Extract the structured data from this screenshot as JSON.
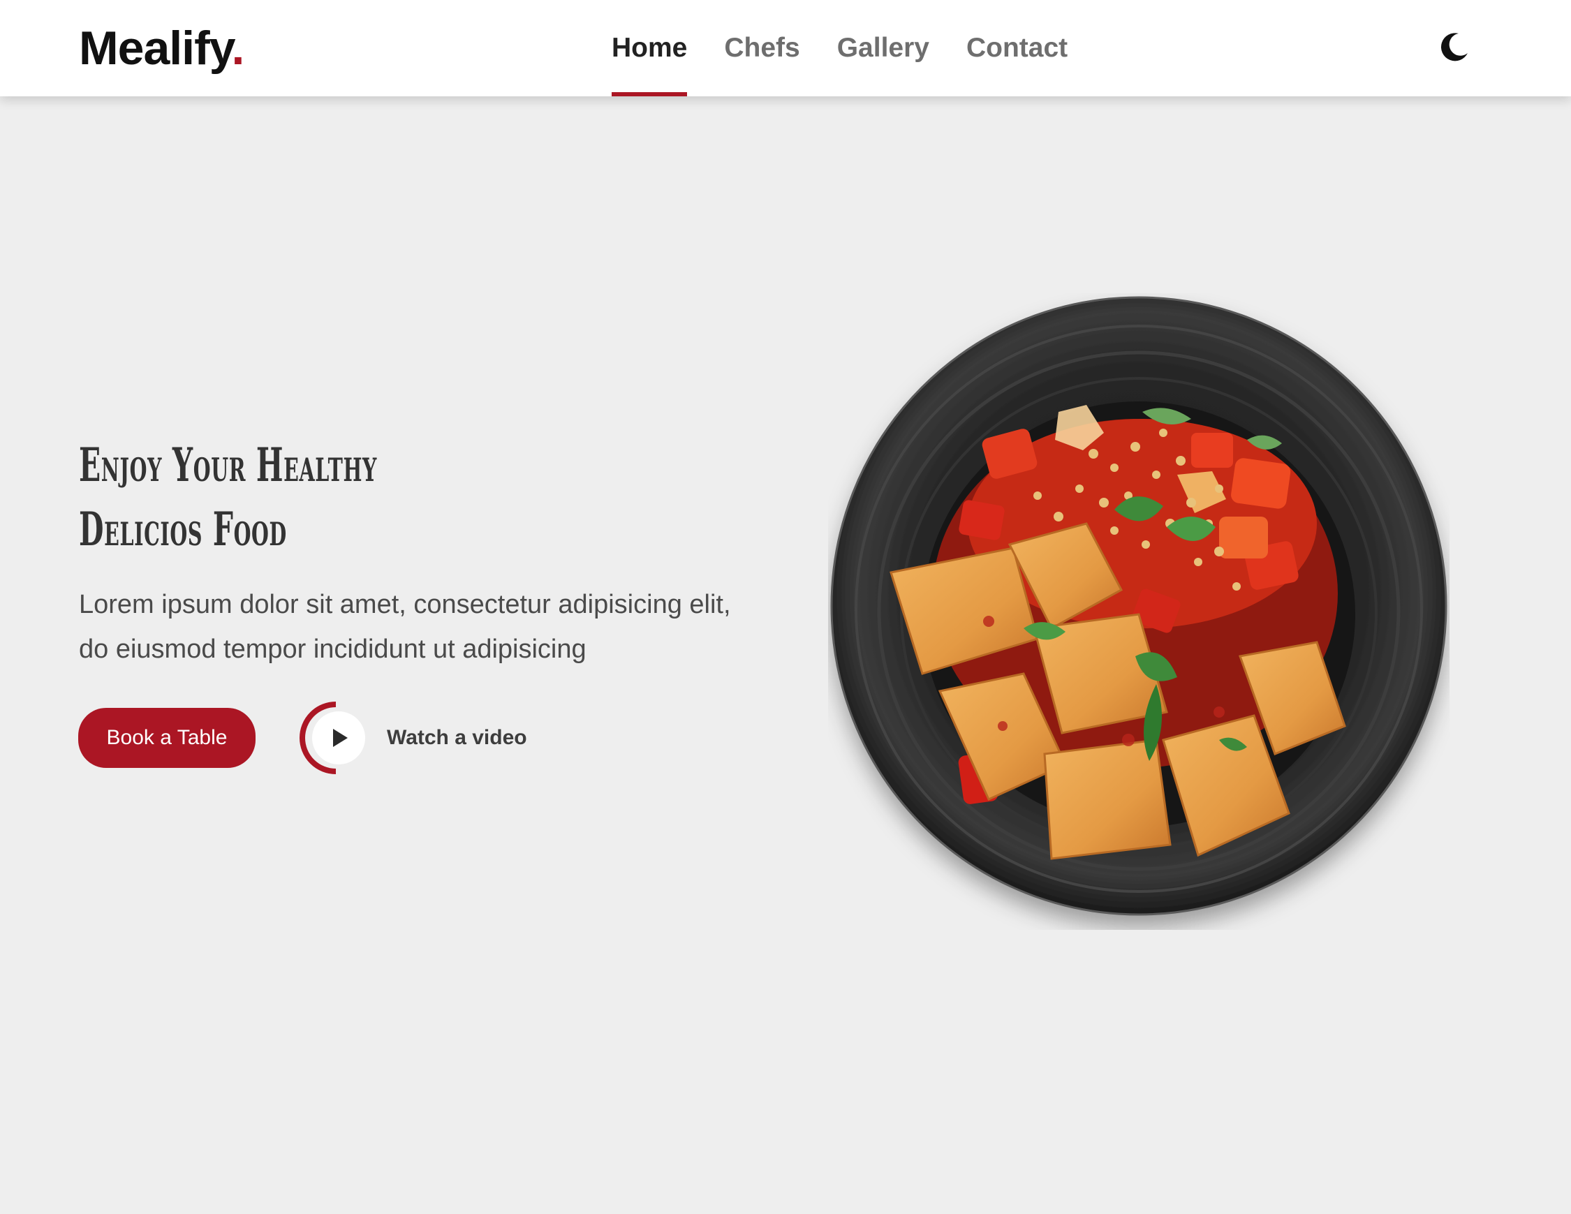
{
  "brand": {
    "name": "Mealify",
    "dot": "."
  },
  "nav": {
    "items": [
      {
        "label": "Home",
        "active": true
      },
      {
        "label": "Chefs",
        "active": false
      },
      {
        "label": "Gallery",
        "active": false
      },
      {
        "label": "Contact",
        "active": false
      }
    ]
  },
  "header": {
    "theme_toggle_icon": "moon-icon"
  },
  "hero": {
    "title_line1": "Enjoy Your Healthy",
    "title_line2": "Delicios Food",
    "description": "Lorem ipsum dolor sit amet, consectetur adipisicing elit, do eiusmod tempor incididunt ut adipisicing",
    "book_label": "Book a Table",
    "video_label": "Watch a video",
    "video_icon": "play-icon",
    "dish_image": "plate-of-food-image"
  },
  "colors": {
    "accent": "#ab1624",
    "background": "#eeeeee",
    "header_bg": "#ffffff",
    "text_dark": "#222222",
    "nav_inactive": "#6e6e6e"
  }
}
